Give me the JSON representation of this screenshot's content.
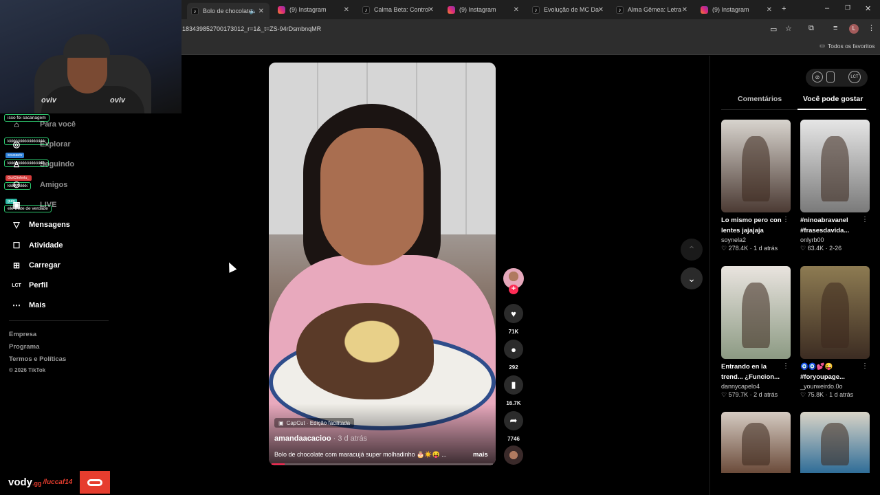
{
  "browser": {
    "tabs": [
      {
        "title": "Bolo de chocolate",
        "icon": "tiktok",
        "active": true,
        "sound": true
      },
      {
        "title": "(9) Instagram",
        "icon": "instagram"
      },
      {
        "title": "Calma Beta: Controle",
        "icon": "tiktok"
      },
      {
        "title": "(9) Instagram",
        "icon": "instagram"
      },
      {
        "title": "Evolução de MC Dan",
        "icon": "tiktok"
      },
      {
        "title": "Alma Gêmea: Letra e",
        "icon": "tiktok"
      },
      {
        "title": "(9) Instagram",
        "icon": "instagram"
      }
    ],
    "url": "183439852700173012_r=1&_t=ZS-94rDsmbnqMR",
    "bookmarks_label": "Todos os favoritos"
  },
  "webcam": {
    "watermark": "oviv"
  },
  "chat": [
    {
      "user": "",
      "text": "isso foi sacanagem"
    },
    {
      "user": "",
      "text": "kkkkkkkkkkkkkkkkk"
    },
    {
      "user": "sousaviv",
      "text": "kkkkkkkkkkkkkkkkk"
    },
    {
      "user": "GuiClinhnlu_",
      "text": "kkkkkkkkk"
    },
    {
      "user": "guto",
      "text": "elé triste de verdade"
    }
  ],
  "sidebar": {
    "items": [
      {
        "label": "Para você",
        "icon": "home-icon",
        "faded": true
      },
      {
        "label": "Explorar",
        "icon": "compass-icon",
        "faded": true
      },
      {
        "label": "Seguindo",
        "icon": "following-icon",
        "faded": true
      },
      {
        "label": "Amigos",
        "icon": "friends-icon",
        "faded": true
      },
      {
        "label": "LIVE",
        "icon": "live-icon",
        "faded": true
      },
      {
        "label": "Mensagens",
        "icon": "messages-icon"
      },
      {
        "label": "Atividade",
        "icon": "activity-icon"
      },
      {
        "label": "Carregar",
        "icon": "upload-icon"
      },
      {
        "label": "Perfil",
        "icon": "profile-icon"
      },
      {
        "label": "Mais",
        "icon": "more-icon"
      }
    ],
    "footer": [
      "Empresa",
      "Programa",
      "Termos e Políticas",
      "© 2026 TikTok"
    ]
  },
  "video": {
    "capcut": "CapCut · Edição facilitada",
    "author": "amandaacacioo",
    "posted": "· 3 d atrás",
    "caption": "Bolo de chocolate com maracujá super molhadinho 🎂☀️😝 ...",
    "more": "mais",
    "progress": 0.06,
    "likes": "71K",
    "comments": "292",
    "saves": "16.7K",
    "shares": "7746"
  },
  "panel": {
    "tab_comments": "Comentários",
    "tab_recommend": "Você pode gostar",
    "cards": [
      {
        "title": "Lo mismo pero con lentes jajajaja",
        "author": "soynela2",
        "likes": "278.4K",
        "age": "1 d atrás",
        "colors": [
          "#d8d4ce",
          "#4b3a33"
        ]
      },
      {
        "title": "#ninoabravanel #frasesdavida...",
        "author": "onlyrb00",
        "likes": "63.4K",
        "age": "2-26",
        "colors": [
          "#e6e6e6",
          "#7a7a7a"
        ]
      },
      {
        "title": "Entrando en la trend... ¿Funcion...",
        "author": "dannycapelo4",
        "likes": "579.7K",
        "age": "2 d atrás",
        "colors": [
          "#e9e4df",
          "#8c9a83"
        ]
      },
      {
        "title": "🧿🧿💕😜 #foryoupage...",
        "author": "_yourweirdo.0o",
        "likes": "75.8K",
        "age": "1 d atrás",
        "colors": [
          "#8d7b52",
          "#3c2c22"
        ]
      },
      {
        "title": "",
        "author": "",
        "likes": "",
        "age": "",
        "colors": [
          "#d5cbc2",
          "#6b4b3a"
        ]
      },
      {
        "title": "",
        "author": "",
        "likes": "",
        "age": "",
        "colors": [
          "#d9d4c7",
          "#2f6d98"
        ]
      }
    ]
  },
  "overlay": {
    "brand": "vody",
    "brand_suffix": ".gg",
    "handle": "/luccaf14"
  }
}
